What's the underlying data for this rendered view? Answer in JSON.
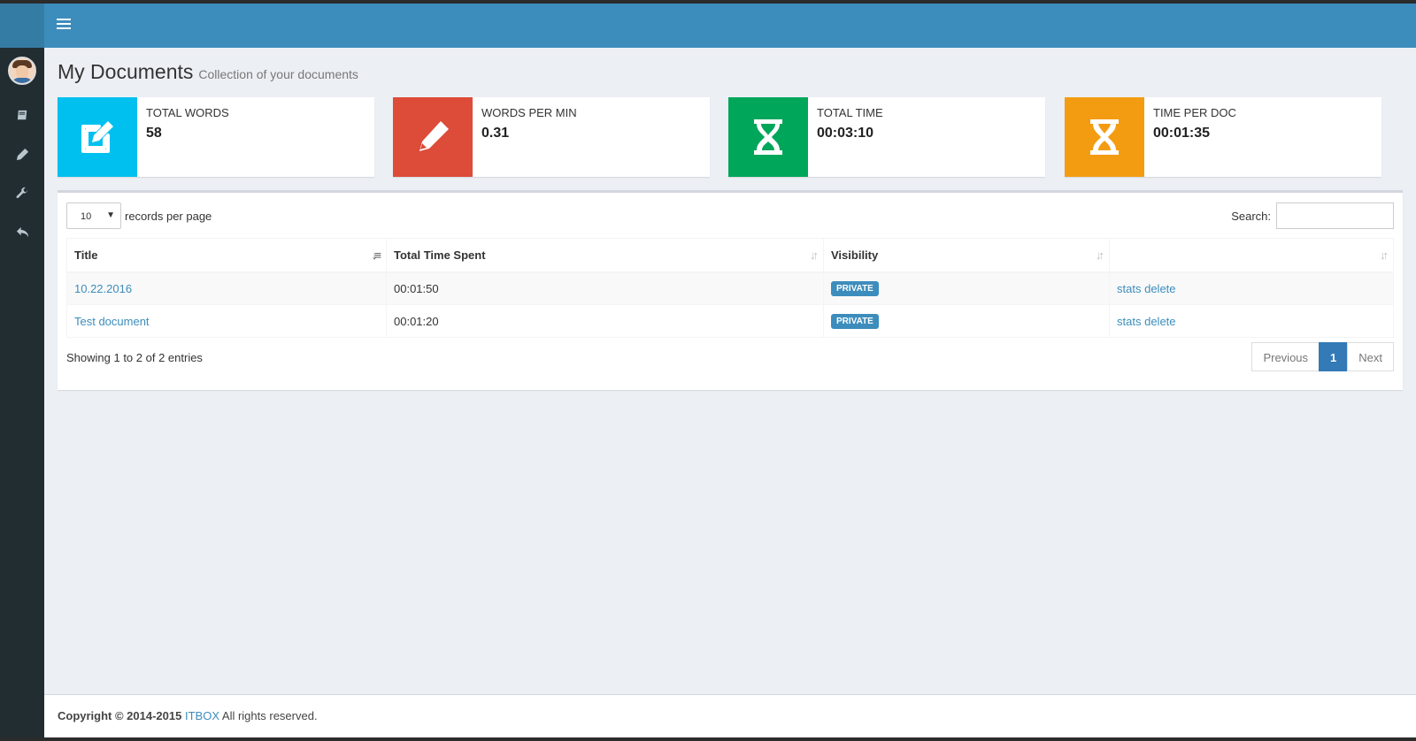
{
  "header": {
    "menu_icon": "bars-icon"
  },
  "sidebar": {
    "items": [
      {
        "icon": "book-icon"
      },
      {
        "icon": "pencil-icon"
      },
      {
        "icon": "wrench-icon"
      },
      {
        "icon": "reply-icon"
      }
    ]
  },
  "page": {
    "title": "My Documents",
    "subtitle": "Collection of your documents"
  },
  "stats": [
    {
      "label": "TOTAL WORDS",
      "value": "58",
      "color": "#00c0ef",
      "icon": "edit-icon"
    },
    {
      "label": "WORDS PER MIN",
      "value": "0.31",
      "color": "#dd4b39",
      "icon": "pencil-icon"
    },
    {
      "label": "TOTAL TIME",
      "value": "00:03:10",
      "color": "#00a65a",
      "icon": "hourglass-icon"
    },
    {
      "label": "TIME PER DOC",
      "value": "00:01:35",
      "color": "#f39c12",
      "icon": "hourglass-icon"
    }
  ],
  "table": {
    "length_value": "10",
    "length_label": "records per page",
    "search_label": "Search:",
    "columns": [
      "Title",
      "Total Time Spent",
      "Visibility",
      ""
    ],
    "rows": [
      {
        "title": "10.22.2016",
        "time": "00:01:50",
        "visibility": "PRIVATE",
        "stats": "stats",
        "delete": "delete"
      },
      {
        "title": "Test document",
        "time": "00:01:20",
        "visibility": "PRIVATE",
        "stats": "stats",
        "delete": "delete"
      }
    ],
    "info": "Showing 1 to 2 of 2 entries",
    "pagination": {
      "previous": "Previous",
      "current": "1",
      "next": "Next"
    }
  },
  "footer": {
    "copyright": "Copyright © 2014-2015",
    "brand": "ITBOX",
    "rights": "All rights reserved."
  }
}
